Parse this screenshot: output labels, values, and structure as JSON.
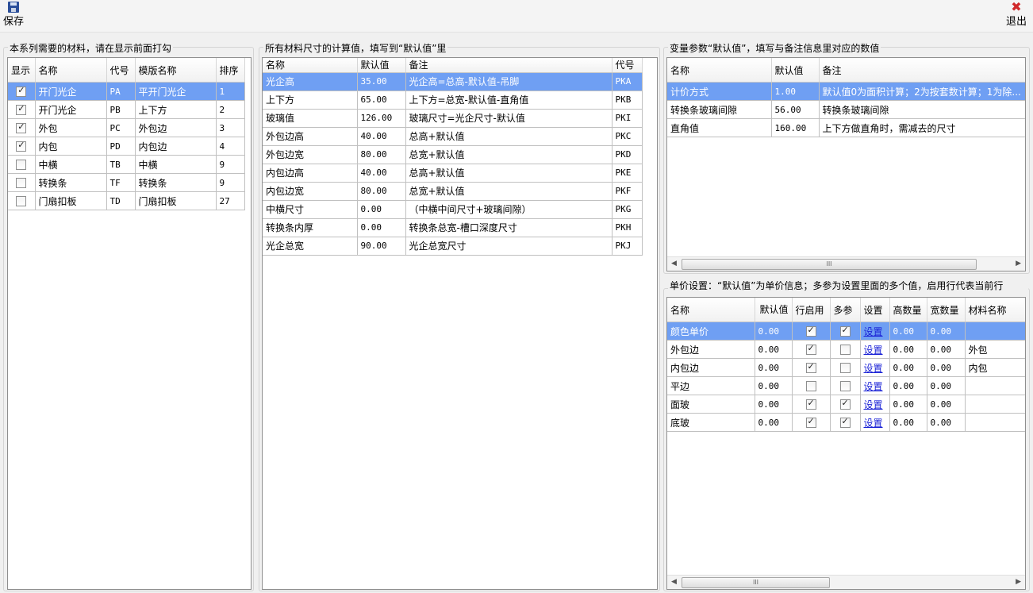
{
  "toolbar": {
    "save_label": "保存",
    "exit_label": "退出",
    "save_icon": "save-disk-icon",
    "exit_icon": "close-x-icon",
    "exit_icon_glyph": "✖"
  },
  "materials_panel": {
    "title": "本系列需要的材料，请在显示前面打勾",
    "columns": [
      "显示",
      "名称",
      "代号",
      "模版名称",
      "排序"
    ],
    "rows": [
      {
        "checked": true,
        "name": "开门光企",
        "code": "PA",
        "template": "平开门光企",
        "order": "1"
      },
      {
        "checked": true,
        "name": "开门光企",
        "code": "PB",
        "template": "上下方",
        "order": "2"
      },
      {
        "checked": true,
        "name": "外包",
        "code": "PC",
        "template": "外包边",
        "order": "3"
      },
      {
        "checked": true,
        "name": "内包",
        "code": "PD",
        "template": "内包边",
        "order": "4"
      },
      {
        "checked": false,
        "name": "中横",
        "code": "TB",
        "template": "中横",
        "order": "9"
      },
      {
        "checked": false,
        "name": "转换条",
        "code": "TF",
        "template": "转换条",
        "order": "9"
      },
      {
        "checked": false,
        "name": "门扇扣板",
        "code": "TD",
        "template": "门扇扣板",
        "order": "27"
      }
    ]
  },
  "sizes_panel": {
    "title": "所有材料尺寸的计算值，填写到“默认值”里",
    "columns": [
      "名称",
      "默认值",
      "备注",
      "代号"
    ],
    "rows": [
      {
        "name": "光企高",
        "value": "35.00",
        "note": "光企高=总高-默认值-吊脚",
        "code": "PKA"
      },
      {
        "name": "上下方",
        "value": "65.00",
        "note": "上下方=总宽-默认值-直角值",
        "code": "PKB"
      },
      {
        "name": "玻璃值",
        "value": "126.00",
        "note": "玻璃尺寸=光企尺寸-默认值",
        "code": "PKI"
      },
      {
        "name": "外包边高",
        "value": "40.00",
        "note": "总高+默认值",
        "code": "PKC"
      },
      {
        "name": "外包边宽",
        "value": "80.00",
        "note": "总宽+默认值",
        "code": "PKD"
      },
      {
        "name": "内包边高",
        "value": "40.00",
        "note": "总高+默认值",
        "code": "PKE"
      },
      {
        "name": "内包边宽",
        "value": "80.00",
        "note": "总宽+默认值",
        "code": "PKF"
      },
      {
        "name": "中横尺寸",
        "value": "0.00",
        "note": "（中横中间尺寸+玻璃间隙）",
        "code": "PKG"
      },
      {
        "name": "转换条内厚",
        "value": "0.00",
        "note": "转换条总宽-槽口深度尺寸",
        "code": "PKH"
      },
      {
        "name": "光企总宽",
        "value": "90.00",
        "note": "光企总宽尺寸",
        "code": "PKJ"
      }
    ]
  },
  "params_panel": {
    "title": "变量参数“默认值”，填写与备注信息里对应的数值",
    "columns": [
      "名称",
      "默认值",
      "备注"
    ],
    "rows": [
      {
        "name": "计价方式",
        "value": "1.00",
        "note": "默认值0为面积计算；2为按套数计算；1为除..."
      },
      {
        "name": "转换条玻璃间隙",
        "value": "56.00",
        "note": "转换条玻璃间隙"
      },
      {
        "name": "直角值",
        "value": "160.00",
        "note": "上下方做直角时，需减去的尺寸"
      }
    ],
    "scroll_grip": "III"
  },
  "price_panel": {
    "title": "单价设置：“默认值”为单价信息；多参为设置里面的多个值，启用行代表当前行",
    "columns": [
      "名称",
      "默认值",
      "行启用",
      "多参",
      "设置",
      "高数量",
      "宽数量",
      "材料名称"
    ],
    "rows": [
      {
        "name": "颜色单价",
        "value": "0.00",
        "enabled": true,
        "multi": true,
        "setting": "设置",
        "h": "0.00",
        "w": "0.00",
        "material": ""
      },
      {
        "name": "外包边",
        "value": "0.00",
        "enabled": true,
        "multi": false,
        "setting": "设置",
        "h": "0.00",
        "w": "0.00",
        "material": "外包"
      },
      {
        "name": "内包边",
        "value": "0.00",
        "enabled": true,
        "multi": false,
        "setting": "设置",
        "h": "0.00",
        "w": "0.00",
        "material": "内包"
      },
      {
        "name": "平边",
        "value": "0.00",
        "enabled": false,
        "multi": false,
        "setting": "设置",
        "h": "0.00",
        "w": "0.00",
        "material": ""
      },
      {
        "name": "面玻",
        "value": "0.00",
        "enabled": true,
        "multi": true,
        "setting": "设置",
        "h": "0.00",
        "w": "0.00",
        "material": ""
      },
      {
        "name": "底玻",
        "value": "0.00",
        "enabled": true,
        "multi": true,
        "setting": "设置",
        "h": "0.00",
        "w": "0.00",
        "material": ""
      }
    ],
    "scroll_grip": "III"
  },
  "colors": {
    "selection": "#6f9ff3",
    "link": "#1a22d6",
    "exit_red": "#d0282a"
  }
}
